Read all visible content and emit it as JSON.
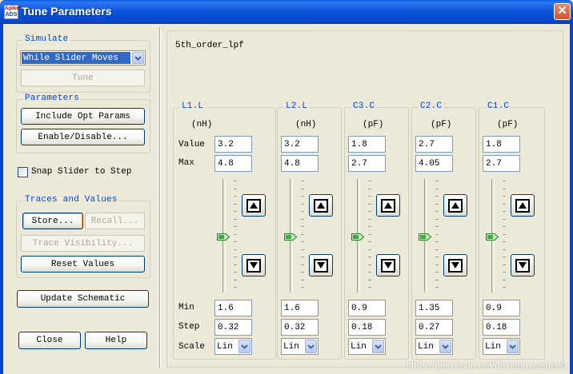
{
  "window": {
    "title": "Tune Parameters",
    "icon_top": "Agilent",
    "icon_bottom": "ADS",
    "close_glyph": "✕"
  },
  "simulate": {
    "label": "Simulate",
    "mode_value": "While Slider Moves",
    "tune_button": "Tune"
  },
  "parameters": {
    "label": "Parameters",
    "include_opt": "Include Opt Params",
    "enable_disable": "Enable/Disable..."
  },
  "snap": {
    "label": "Snap Slider to Step",
    "checked": false
  },
  "traces": {
    "label": "Traces and Values",
    "store": "Store...",
    "recall": "Recall...",
    "trace_visibility": "Trace Visibility...",
    "reset_values": "Reset Values"
  },
  "update_schematic": "Update Schematic",
  "close_button": "Close",
  "help_button": "Help",
  "design_name": "5th_order_lpf",
  "row_labels": {
    "value": "Value",
    "max": "Max",
    "min": "Min",
    "step": "Step",
    "scale": "Scale"
  },
  "params": [
    {
      "name": "L1.L",
      "unit": "(nH)",
      "value": "3.2",
      "max": "4.8",
      "min": "1.6",
      "step": "0.32",
      "scale": "Lin"
    },
    {
      "name": "L2.L",
      "unit": "(nH)",
      "value": "3.2",
      "max": "4.8",
      "min": "1.6",
      "step": "0.32",
      "scale": "Lin"
    },
    {
      "name": "C3.C",
      "unit": "(pF)",
      "value": "1.8",
      "max": "2.7",
      "min": "0.9",
      "step": "0.18",
      "scale": "Lin"
    },
    {
      "name": "C2.C",
      "unit": "(pF)",
      "value": "2.7",
      "max": "4.05",
      "min": "1.35",
      "step": "0.27",
      "scale": "Lin"
    },
    {
      "name": "C1.C",
      "unit": "(pF)",
      "value": "1.8",
      "max": "2.7",
      "min": "0.9",
      "step": "0.18",
      "scale": "Lin"
    }
  ],
  "watermark": "https://blog.csdn.net/daxiangwusheng",
  "colors": {
    "title_bar": "#0845c9",
    "group_label": "#0046d5",
    "selection": "#316ac5",
    "slider_thumb": "#44a844"
  }
}
